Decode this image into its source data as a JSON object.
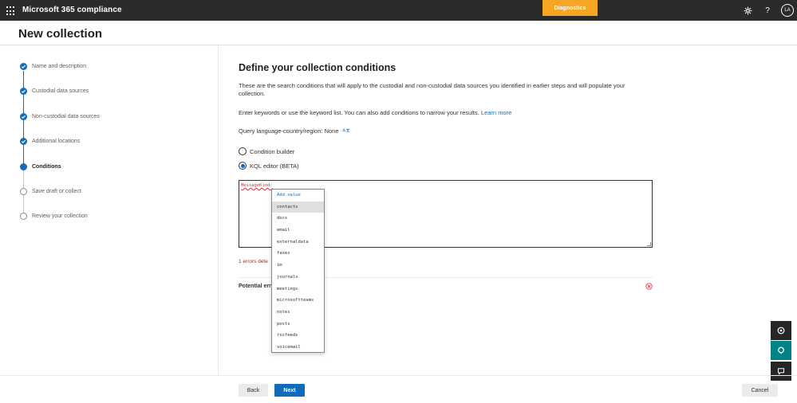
{
  "app": {
    "title": "Microsoft 365 compliance",
    "diagnostics_label": "Diagnostics",
    "user_initials": "LA"
  },
  "page": {
    "title": "New collection"
  },
  "steps": [
    {
      "label": "Name and description",
      "state": "done"
    },
    {
      "label": "Custodial data sources",
      "state": "done"
    },
    {
      "label": "Non-custodial data sources",
      "state": "done"
    },
    {
      "label": "Additional locations",
      "state": "done"
    },
    {
      "label": "Conditions",
      "state": "current"
    },
    {
      "label": "Save draft or collect",
      "state": "todo"
    },
    {
      "label": "Review your collection",
      "state": "todo"
    }
  ],
  "main": {
    "heading": "Define your collection conditions",
    "description": "These are the search conditions that will apply to the custodial and non-custodial data sources you identified in earlier steps and will populate your collection.",
    "keywords_text": "Enter keywords or use the keyword list. You can also add conditions to narrow your results.",
    "learn_more": "Learn more",
    "query_language": "Query language-country/region: None",
    "options": [
      {
        "label": "Condition builder",
        "selected": false
      },
      {
        "label": "KQL editor (BETA)",
        "selected": true
      }
    ],
    "kql_value": "MessageKind:",
    "errors_text": "1 errors dete",
    "potential_errors_label": "Potential err"
  },
  "dropdown": {
    "header": "Add value",
    "items": [
      "contacts",
      "docs",
      "email",
      "externaldata",
      "faxes",
      "im",
      "journals",
      "meetings",
      "microsoftteams",
      "notes",
      "posts",
      "rssfeeds",
      "voicemail"
    ],
    "selected": "contacts"
  },
  "footer": {
    "back_label": "Back",
    "next_label": "Next",
    "cancel_label": "Cancel"
  },
  "colors": {
    "accent": "#0f6cbd",
    "topbar": "#2b2b2b",
    "diagnostics": "#f6a623",
    "error": "#d13438"
  },
  "icons": [
    "waffle-icon",
    "settings-icon",
    "help-icon",
    "translate-icon",
    "error-circle-icon",
    "feedback-icon",
    "chat-icon"
  ]
}
